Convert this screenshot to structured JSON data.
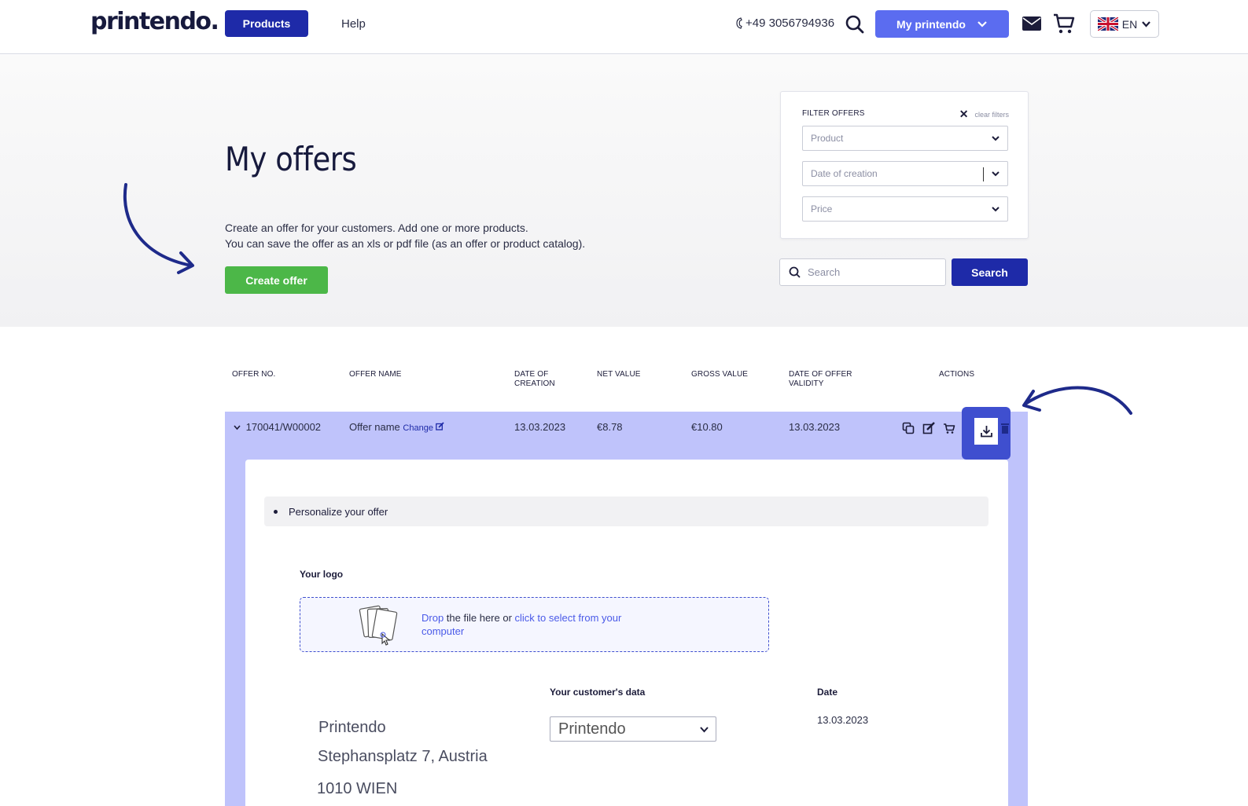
{
  "header": {
    "logo": "printendo.",
    "products_label": "Products",
    "help_label": "Help",
    "phone": "+49 3056794936",
    "my_printendo_label": "My printendo",
    "language": "EN"
  },
  "hero": {
    "title": "My offers",
    "description_line1": "Create an offer for your customers. Add one or more products.",
    "description_line2": "You can save the offer as an xls or pdf file (as an offer or product catalog).",
    "create_offer_label": "Create offer"
  },
  "filters": {
    "title": "FILTER OFFERS",
    "clear_label": "clear filters",
    "product_placeholder": "Product",
    "date_placeholder": "Date of creation",
    "price_placeholder": "Price",
    "search_placeholder": "Search",
    "search_button": "Search"
  },
  "table": {
    "headers": {
      "offer_no": "OFFER NO.",
      "offer_name": "OFFER NAME",
      "date_creation_1": "DATE OF",
      "date_creation_2": "CREATION",
      "net_value": "NET VALUE",
      "gross_value": "GROSS VALUE",
      "validity_1": "DATE OF OFFER",
      "validity_2": "VALIDITY",
      "actions": "ACTIONS"
    },
    "row": {
      "offer_no": "170041/W00002",
      "offer_name": "Offer name",
      "change_label": "Change",
      "date_creation": "13.03.2023",
      "net_value": "€8.78",
      "gross_value": "€10.80",
      "validity": "13.03.2023"
    }
  },
  "detail": {
    "personalize_label": "Personalize your offer",
    "your_logo_label": "Your logo",
    "drop_link": "Drop",
    "drop_middle": " the file here or ",
    "drop_select": "click to select from your computer",
    "customer_data_label": "Your customer's data",
    "customer_selected": "Printendo",
    "date_label": "Date",
    "date_value": "13.03.2023",
    "address_name": "Printendo",
    "address_street": "Stephansplatz 7, Austria",
    "address_city": "1010 WIEN"
  },
  "colors": {
    "primary": "#1e2aa8",
    "accent": "#5b6cf0",
    "success": "#4cb748",
    "panel": "#bfc3fb"
  }
}
